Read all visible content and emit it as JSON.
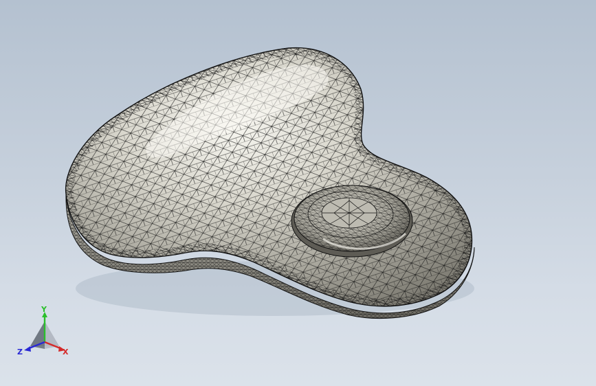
{
  "viewport": {
    "background_top": "#b4c1d0",
    "background_bottom": "#dbe2ea",
    "display_mode": "wireframe-shaded",
    "model_color": "#a9a79d",
    "edge_color": "#000000"
  },
  "triad": {
    "x_label": "X",
    "y_label": "Y",
    "z_label": "Z",
    "x_color": "#d42a2a",
    "y_color": "#2bbf2b",
    "z_color": "#2a2ad4"
  }
}
